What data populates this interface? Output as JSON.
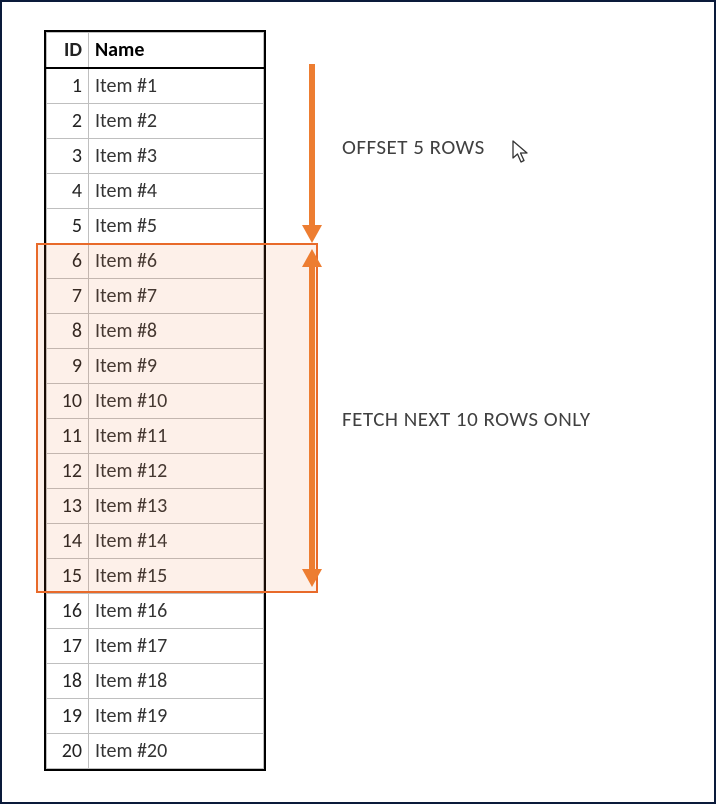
{
  "table": {
    "headers": {
      "id": "ID",
      "name": "Name"
    },
    "rows": [
      {
        "id": "1",
        "name": "Item #1"
      },
      {
        "id": "2",
        "name": "Item #2"
      },
      {
        "id": "3",
        "name": "Item #3"
      },
      {
        "id": "4",
        "name": "Item #4"
      },
      {
        "id": "5",
        "name": "Item #5"
      },
      {
        "id": "6",
        "name": "Item #6"
      },
      {
        "id": "7",
        "name": "Item #7"
      },
      {
        "id": "8",
        "name": "Item #8"
      },
      {
        "id": "9",
        "name": "Item #9"
      },
      {
        "id": "10",
        "name": "Item #10"
      },
      {
        "id": "11",
        "name": "Item #11"
      },
      {
        "id": "12",
        "name": "Item #12"
      },
      {
        "id": "13",
        "name": "Item #13"
      },
      {
        "id": "14",
        "name": "Item #14"
      },
      {
        "id": "15",
        "name": "Item #15"
      },
      {
        "id": "16",
        "name": "Item #16"
      },
      {
        "id": "17",
        "name": "Item #17"
      },
      {
        "id": "18",
        "name": "Item #18"
      },
      {
        "id": "19",
        "name": "Item #19"
      },
      {
        "id": "20",
        "name": "Item #20"
      }
    ],
    "highlight": {
      "start_row_index": 5,
      "count": 10
    }
  },
  "labels": {
    "offset": "OFFSET 5 ROWS",
    "fetch": "FETCH NEXT 10 ROWS ONLY"
  },
  "colors": {
    "arrow": "#ed7d31",
    "highlight_border": "#e86a2a",
    "highlight_fill": "rgba(232,106,42,0.10)"
  }
}
